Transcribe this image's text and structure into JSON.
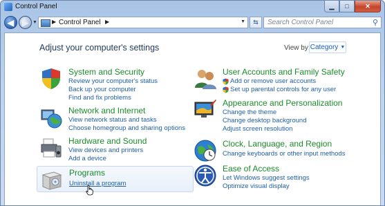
{
  "window": {
    "title": "Control Panel"
  },
  "address": {
    "crumbs": [
      "Control Panel"
    ]
  },
  "search": {
    "placeholder": "Search Control Panel"
  },
  "main": {
    "heading": "Adjust your computer's settings",
    "view_by_label": "View by:",
    "view_by_value": "Category"
  },
  "categories": {
    "system": {
      "title": "System and Security",
      "links": [
        "Review your computer's status",
        "Back up your computer",
        "Find and fix problems"
      ]
    },
    "network": {
      "title": "Network and Internet",
      "links": [
        "View network status and tasks",
        "Choose homegroup and sharing options"
      ]
    },
    "hardware": {
      "title": "Hardware and Sound",
      "links": [
        "View devices and printers",
        "Add a device"
      ]
    },
    "programs": {
      "title": "Programs",
      "links": [
        "Uninstall a program"
      ]
    },
    "users": {
      "title": "User Accounts and Family Safety",
      "links": [
        "Add or remove user accounts",
        "Set up parental controls for any user"
      ]
    },
    "appearance": {
      "title": "Appearance and Personalization",
      "links": [
        "Change the theme",
        "Change desktop background",
        "Adjust screen resolution"
      ]
    },
    "clock": {
      "title": "Clock, Language, and Region",
      "links": [
        "Change keyboards or other input methods"
      ]
    },
    "ease": {
      "title": "Ease of Access",
      "links": [
        "Let Windows suggest settings",
        "Optimize visual display"
      ]
    }
  },
  "colors": {
    "category_title": "#1b8c2b",
    "link": "#1e5fa8",
    "frame": "#bcd2ee"
  },
  "icons": [
    "back-arrow-icon",
    "forward-arrow-icon",
    "control-panel-icon",
    "refresh-icon",
    "search-icon",
    "shield-icon",
    "network-globe-icon",
    "printer-icon",
    "programs-box-icon",
    "users-icon",
    "display-icon",
    "clock-globe-icon",
    "ease-of-access-icon",
    "hand-cursor-icon"
  ]
}
